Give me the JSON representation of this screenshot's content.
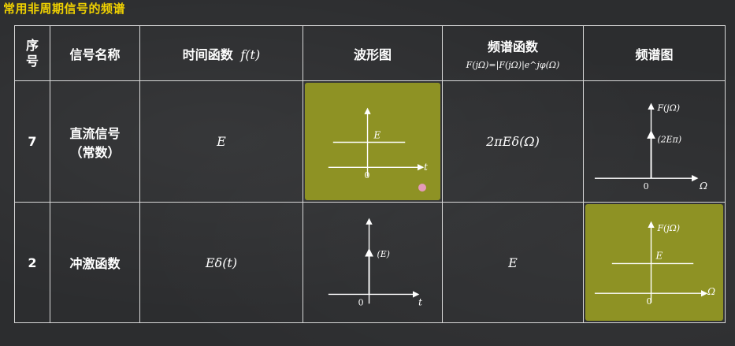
{
  "page_title": "常用非周期信号的频谱",
  "header": {
    "col_index": "序号",
    "col_name": "信号名称",
    "col_time_fn_label": "时间函数",
    "col_time_fn_math": "f(t)",
    "col_waveform": "波形图",
    "col_spectrum_fn": "频谱函数",
    "col_spectrum_fn_formula": "F(jΩ)=|F(jΩ)|e^jφ(Ω)",
    "col_spectrum_plot": "频谱图"
  },
  "rows": [
    {
      "index": "7",
      "name_line1": "直流信号",
      "name_line2": "（常数）",
      "time_fn": "E",
      "waveform": {
        "level_label": "E",
        "origin": "0",
        "axis": "t"
      },
      "spectrum_fn": "2πEδ(Ω)",
      "spectrum_plot": {
        "y_label": "F(jΩ)",
        "impulse_label": "(2Eπ)",
        "origin": "0",
        "axis": "Ω"
      }
    },
    {
      "index": "2",
      "name_line1": "冲激函数",
      "time_fn": "Eδ(t)",
      "waveform": {
        "impulse_label": "(E)",
        "origin": "0",
        "axis": "t"
      },
      "spectrum_fn": "E",
      "spectrum_plot": {
        "y_label": "F(jΩ)",
        "level_label": "E",
        "origin": "0",
        "axis": "Ω"
      }
    }
  ],
  "colors": {
    "title": "#f1d200",
    "highlight": "#8e9224",
    "background": "#2c2d2f"
  }
}
